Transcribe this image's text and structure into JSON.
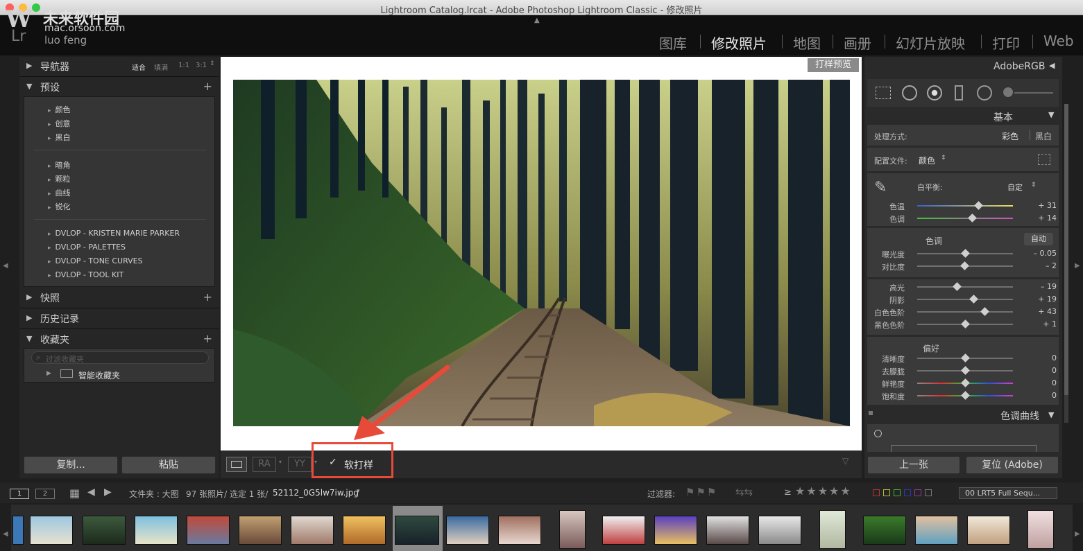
{
  "window_title": "Lightroom Catalog.lrcat - Adobe Photoshop Lightroom Classic - 修改照片",
  "watermark": {
    "line1": "未来软件园",
    "line2": "mac.orsoon.com"
  },
  "user_name": "luo feng",
  "lr_logo": "Lr",
  "modules": [
    {
      "label": "图库",
      "active": false
    },
    {
      "label": "修改照片",
      "active": true
    },
    {
      "label": "地图",
      "active": false
    },
    {
      "label": "画册",
      "active": false
    },
    {
      "label": "幻灯片放映",
      "active": false
    },
    {
      "label": "打印",
      "active": false
    },
    {
      "label": "Web",
      "active": false
    }
  ],
  "left_panel": {
    "navigator": {
      "title": "导航器",
      "zoom": [
        "适合",
        "填满",
        "1:1",
        "3:1"
      ]
    },
    "presets": {
      "title": "预设",
      "group1": [
        "颜色",
        "创意",
        "黑白"
      ],
      "group2": [
        "暗角",
        "颗粒",
        "曲线",
        "锐化"
      ],
      "group3": [
        "DVLOP - KRISTEN MARIE PARKER",
        "DVLOP - PALETTES",
        "DVLOP - TONE CURVES",
        "DVLOP - TOOL KIT"
      ]
    },
    "snapshots": "快照",
    "history": "历史记录",
    "collections": {
      "title": "收藏夹",
      "filter_placeholder": "过滤收藏夹",
      "smart": "智能收藏夹"
    },
    "copy_button": "复制...",
    "paste_button": "粘贴"
  },
  "center": {
    "proof_label": "打样预览",
    "soft_proof_label": "软打样",
    "soft_proof_checked": true
  },
  "right_panel": {
    "profile_name": "AdobeRGB",
    "basic_title": "基本",
    "treatment_label": "处理方式:",
    "treatment_color": "彩色",
    "treatment_bw": "黑白",
    "profile_label": "配置文件:",
    "profile_value": "颜色",
    "wb_label": "白平衡:",
    "wb_value": "自定",
    "tone_label": "色调",
    "auto_label": "自动",
    "presence_label": "偏好",
    "sliders": [
      {
        "label": "色温",
        "value": "+ 31",
        "pos": 0.64
      },
      {
        "label": "色调",
        "value": "+ 14",
        "pos": 0.57
      },
      {
        "label": "曝光度",
        "value": "– 0.05",
        "pos": 0.5
      },
      {
        "label": "对比度",
        "value": "– 2",
        "pos": 0.49
      },
      {
        "label": "高光",
        "value": "– 19",
        "pos": 0.41
      },
      {
        "label": "阴影",
        "value": "+ 19",
        "pos": 0.59
      },
      {
        "label": "白色色阶",
        "value": "+ 43",
        "pos": 0.7
      },
      {
        "label": "黑色色阶",
        "value": "+ 1",
        "pos": 0.5
      },
      {
        "label": "清晰度",
        "value": "0",
        "pos": 0.5
      },
      {
        "label": "去朦胧",
        "value": "0",
        "pos": 0.5
      },
      {
        "label": "鲜艳度",
        "value": "0",
        "pos": 0.5
      },
      {
        "label": "饱和度",
        "value": "0",
        "pos": 0.5
      }
    ],
    "tone_curve_title": "色调曲线",
    "prev_button": "上一张",
    "reset_button": "复位 (Adobe)"
  },
  "filmbar": {
    "screen1": "1",
    "screen2": "2",
    "source": "文件夹 : 大图",
    "count": "97 张照片/ 选定 1 张/",
    "filename": "52112_0G5lw7iw.jpg",
    "filter_label": "过滤器:",
    "gte": "≥",
    "filter_preset": "00 LRT5 Full Sequ..."
  }
}
